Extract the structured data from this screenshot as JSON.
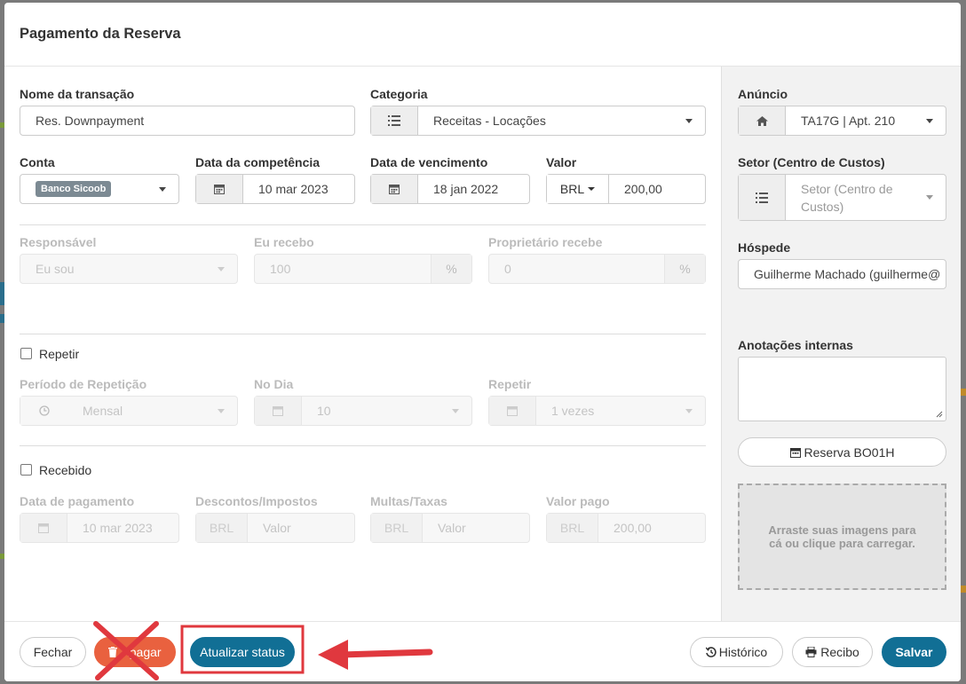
{
  "modal": {
    "title": "Pagamento da Reserva"
  },
  "form": {
    "nome_label": "Nome da transação",
    "nome_value": "Res. Downpayment",
    "categoria_label": "Categoria",
    "categoria_value": "Receitas - Locações",
    "conta_label": "Conta",
    "conta_value": "Banco Sicoob",
    "competencia_label": "Data da competência",
    "competencia_value": "10 mar 2023",
    "vencimento_label": "Data de vencimento",
    "vencimento_value": "18 jan 2022",
    "valor_label": "Valor",
    "valor_currency": "BRL",
    "valor_value": "200,00",
    "responsavel_label": "Responsável",
    "responsavel_value": "Eu sou",
    "eu_recebo_label": "Eu recebo",
    "eu_recebo_value": "100",
    "proprietario_label": "Proprietário recebe",
    "proprietario_value": "0",
    "percent": "%",
    "repetir_check_label": "Repetir",
    "periodo_label": "Período de Repetição",
    "periodo_value": "Mensal",
    "no_dia_label": "No Dia",
    "no_dia_value": "10",
    "repetir_label": "Repetir",
    "repetir_value": "1 vezes",
    "recebido_label": "Recebido",
    "data_pagamento_label": "Data de pagamento",
    "data_pagamento_value": "10 mar 2023",
    "descontos_label": "Descontos/Impostos",
    "descontos_currency": "BRL",
    "descontos_placeholder": "Valor",
    "multas_label": "Multas/Taxas",
    "multas_currency": "BRL",
    "multas_placeholder": "Valor",
    "valor_pago_label": "Valor pago",
    "valor_pago_currency": "BRL",
    "valor_pago_value": "200,00"
  },
  "side": {
    "anuncio_label": "Anúncio",
    "anuncio_value": "TA17G | Apt. 210",
    "setor_label": "Setor (Centro de Custos)",
    "setor_placeholder": "Setor (Centro de Custos)",
    "hospede_label": "Hóspede",
    "hospede_value": "Guilherme Machado (guilherme@",
    "anotacoes_label": "Anotações internas",
    "reserva_button": "Reserva BO01H",
    "dropzone_text": "Arraste suas imagens para cá ou clique para carregar."
  },
  "footer": {
    "fechar": "Fechar",
    "apagar": "Apagar",
    "atualizar": "Atualizar status",
    "historico": "Histórico",
    "recibo": "Recibo",
    "salvar": "Salvar"
  },
  "colors": {
    "primary": "#116f95",
    "danger": "#e9613f",
    "annotation": "#e0383e"
  }
}
